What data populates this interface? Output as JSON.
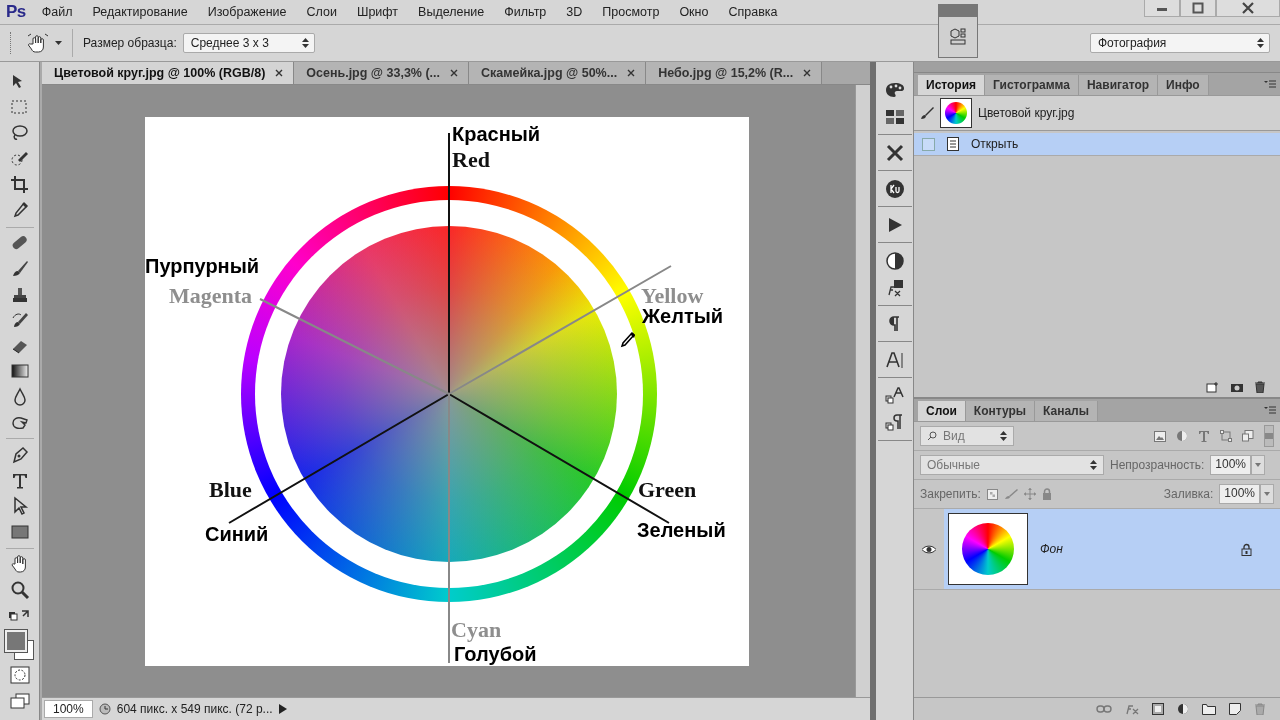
{
  "app": {
    "logo": "Ps"
  },
  "menu": [
    "Файл",
    "Редактирование",
    "Изображение",
    "Слои",
    "Шрифт",
    "Выделение",
    "Фильтр",
    "3D",
    "Просмотр",
    "Окно",
    "Справка"
  ],
  "options_bar": {
    "sample_size_label": "Размер образца:",
    "sample_size": "Среднее 3 х 3",
    "workspace": "Фотография"
  },
  "doc_tabs": [
    {
      "label": "Цветовой круг.jpg @ 100% (RGB/8)",
      "selected": true
    },
    {
      "label": "Осень.jpg @ 33,3% (...",
      "selected": false
    },
    {
      "label": "Скамейка.jpg @ 50%...",
      "selected": false
    },
    {
      "label": "Небо.jpg @ 15,2% (R...",
      "selected": false
    }
  ],
  "canvas": {
    "labels": [
      {
        "text": "Красный",
        "kind": "ru"
      },
      {
        "text": "Red",
        "kind": "en_dark"
      },
      {
        "text": "Пурпурный",
        "kind": "ru"
      },
      {
        "text": "Magenta",
        "kind": "en_light"
      },
      {
        "text": "Yellow",
        "kind": "en_light"
      },
      {
        "text": "Желтый",
        "kind": "ru"
      },
      {
        "text": "Blue",
        "kind": "en_dark"
      },
      {
        "text": "Синий",
        "kind": "ru"
      },
      {
        "text": "Green",
        "kind": "en_dark"
      },
      {
        "text": "Зеленый",
        "kind": "ru"
      },
      {
        "text": "Cyan",
        "kind": "en_light"
      },
      {
        "text": "Голубой",
        "kind": "ru"
      }
    ]
  },
  "status_bar": {
    "zoom": "100%",
    "info": "604 пикс. x 549 пикс. (72 р..."
  },
  "history_panel": {
    "tabs": [
      {
        "label": "История",
        "selected": true
      },
      {
        "label": "Гистограмма",
        "selected": false
      },
      {
        "label": "Навигатор",
        "selected": false
      },
      {
        "label": "Инфо",
        "selected": false
      }
    ],
    "snapshot": "Цветовой круг.jpg",
    "steps": [
      {
        "label": "Открыть",
        "selected": true
      }
    ]
  },
  "layers_panel": {
    "tabs": [
      {
        "label": "Слои",
        "selected": true
      },
      {
        "label": "Контуры",
        "selected": false
      },
      {
        "label": "Каналы",
        "selected": false
      }
    ],
    "filter": "Вид",
    "blend_mode": "Обычные",
    "opacity_label": "Непрозрачность:",
    "opacity": "100%",
    "lock_label": "Закрепить:",
    "fill_label": "Заливка:",
    "fill": "100%",
    "layers": [
      {
        "name": "Фон",
        "visible": true,
        "selected": true,
        "locked": true
      }
    ]
  }
}
